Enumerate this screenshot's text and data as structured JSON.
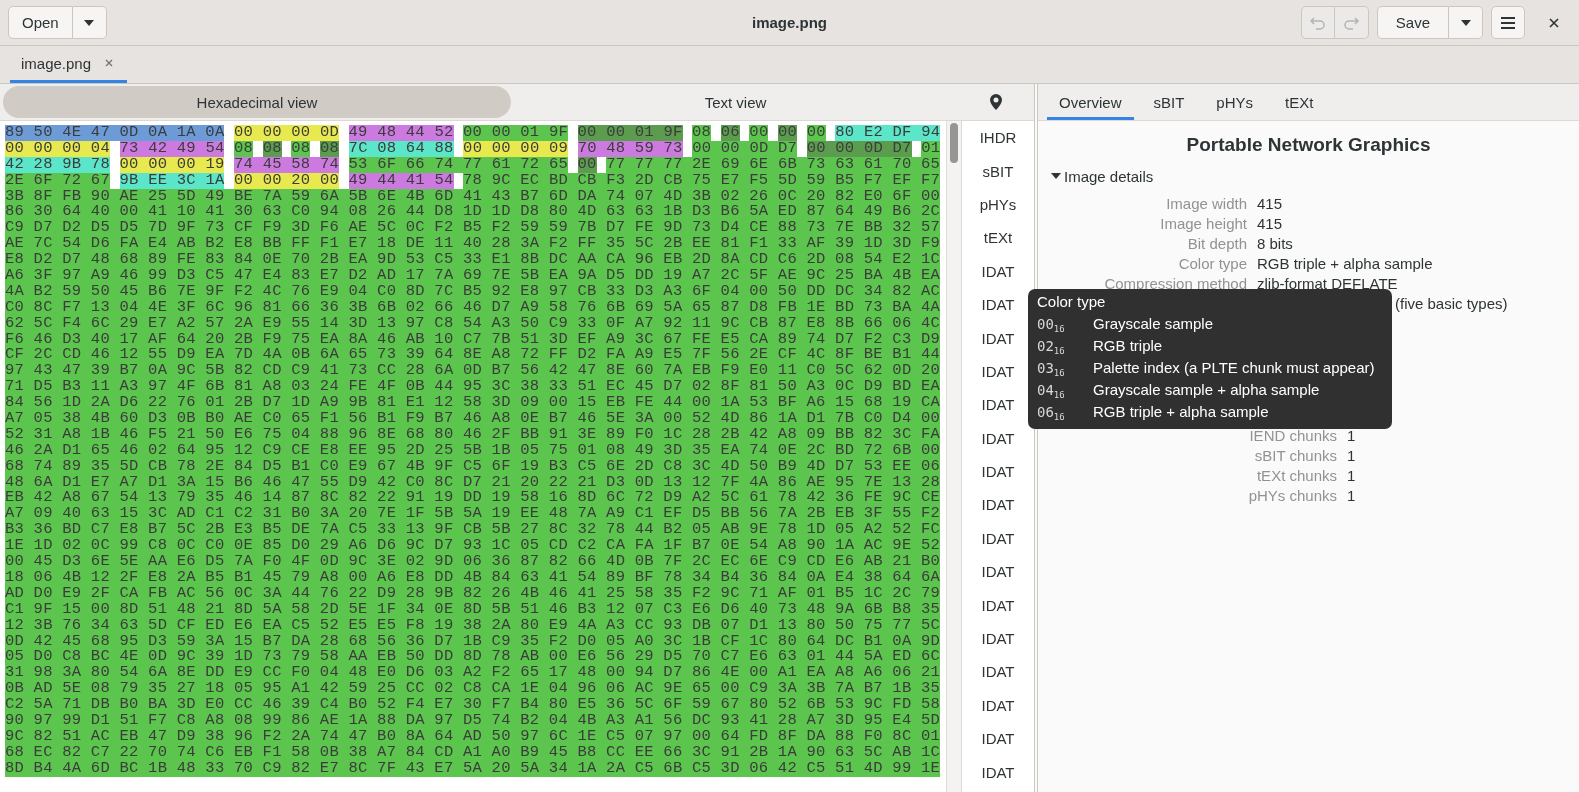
{
  "header": {
    "open_button": "Open",
    "title": "image.png",
    "undo": {
      "disabled": true
    },
    "redo": {
      "disabled": true
    },
    "save_button": "Save"
  },
  "tabs": [
    {
      "label": "image.png",
      "selected": true
    }
  ],
  "view_switch": [
    {
      "label": "Hexadecimal view",
      "selected": true
    },
    {
      "label": "Text view",
      "selected": false
    }
  ],
  "hex_rows": [
    {
      "segments": [
        {
          "bytes": "89 50 4E 47 0D 0A 1A 0A",
          "color": "#6d9bd8"
        },
        {
          "bytes": "00 00 00 0D",
          "color": "#e8e84f"
        },
        {
          "bytes": "49 48 44 52",
          "color": "#cc7adf"
        },
        {
          "bytes": "00 00 01 9F",
          "color": "#5cc54d"
        },
        {
          "bytes": "00 00 01 9F",
          "color": "#5b9c4f"
        },
        {
          "bytes": "08",
          "color": "#5cc54d"
        },
        {
          "bytes": "06",
          "color": "#5b9c4f"
        },
        {
          "bytes": "00",
          "color": "#5cc54d"
        },
        {
          "bytes": "00",
          "color": "#5b9c4f"
        },
        {
          "bytes": "00",
          "color": "#5cc54d"
        },
        {
          "bytes": "80 E2 DF 94",
          "color": "#5ce6c9"
        }
      ]
    },
    {
      "segments": [
        {
          "bytes": "00 00 00 04",
          "color": "#e8e84f"
        },
        {
          "bytes": "73 42 49 54",
          "color": "#cc7adf"
        },
        {
          "bytes": "08",
          "color": "#5cc54d"
        },
        {
          "bytes": "08",
          "color": "#5b9c4f"
        },
        {
          "bytes": "08",
          "color": "#5cc54d"
        },
        {
          "bytes": "08",
          "color": "#5b9c4f"
        },
        {
          "bytes": "7C 08 64 88",
          "color": "#5ce6c9"
        },
        {
          "bytes": "00 00 00 09",
          "color": "#e8e84f"
        },
        {
          "bytes": "70 48 59 73",
          "color": "#cc7adf"
        },
        {
          "bytes": "00 00 0D D7",
          "color": "#5cc54d"
        },
        {
          "bytes": "00 00 0D D7",
          "color": "#5b9c4f"
        },
        {
          "bytes": "01",
          "color": "#5cc54d"
        }
      ]
    },
    {
      "segments": [
        {
          "bytes": "42 28 9B 78",
          "color": "#5ce6c9"
        },
        {
          "bytes": "00 00 00 19",
          "color": "#e8e84f"
        },
        {
          "bytes": "74 45 58 74",
          "color": "#cc7adf"
        },
        {
          "bytes": "53 6F 66 74 77 61 72 65",
          "color": "#5cc54d"
        },
        {
          "bytes": "00",
          "color": "#5b9c4f"
        },
        {
          "bytes": "77 77 77 2E 69 6E 6B 73 63 61 70 65",
          "color": "#5cc54d"
        }
      ]
    },
    {
      "segments": [
        {
          "bytes": "2E 6F 72 67",
          "color": "#5cc54d"
        },
        {
          "bytes": "9B EE 3C 1A",
          "color": "#5ce6c9"
        },
        {
          "bytes": "00 00 20 00",
          "color": "#e8e84f"
        },
        {
          "bytes": "49 44 41 54",
          "color": "#cc7adf"
        },
        {
          "bytes": "78 9C EC BD CB F3 2D CB 75 E7 F5 5D 59 B5 F7 EF F7",
          "color": "#5cc54d"
        }
      ]
    },
    {
      "segments": [
        {
          "bytes": "3B 8F FB 90 AE 25 5D 49 BE 7A 59 6A 5B 6E 4B 6D 41 43 B7 6D DA 74 07 4D 3B 02 26 0C 20 82 E0 6F 00",
          "color": "#5cc54d"
        }
      ]
    },
    {
      "segments": [
        {
          "bytes": "86 30 64 40 00 41 10 41 30 63 C0 94 08 26 44 D8 1D 1D D8 80 4D 63 63 1B D3 B6 5A ED 87 64 49 B6 2C",
          "color": "#5cc54d"
        }
      ]
    },
    {
      "segments": [
        {
          "bytes": "C9 D7 D2 D5 D5 7D 9F 73 CF F9 3D F6 AE 5C 0C F2 B5 F2 59 59 7B D7 FE 9D 73 D4 CE 88 73 7E BB 32 57",
          "color": "#5cc54d"
        }
      ]
    },
    {
      "segments": [
        {
          "bytes": "AE 7C 54 D6 FA E4 AB B2 E8 BB FF F1 E7 18 DE 11 40 28 3A F2 FF 35 5C 2B EE 81 F1 33 AF 39 1D 3D F9",
          "color": "#5cc54d"
        }
      ]
    },
    {
      "segments": [
        {
          "bytes": "E8 D2 D7 48 68 89 FE 83 84 0E 70 2B EA 9D 53 C5 33 E1 8B DC AA CA 96 EB 2D 8A CD C6 2D 08 54 E2 1C",
          "color": "#5cc54d"
        }
      ]
    },
    {
      "segments": [
        {
          "bytes": "A6 3F 97 A9 46 99 D3 C5 47 E4 83 E7 D2 AD 17 7A 69 7E 5B EA 9A D5 DD 19 A7 2C 5F AE 9C 25 BA 4B EA",
          "color": "#5cc54d"
        }
      ]
    },
    {
      "segments": [
        {
          "bytes": "4A B2 59 50 45 B6 7E 9F F2 4C 76 E9 04 C0 8D 7C B5 92 E8 97 CB 33 D3 A3 6F 04 00 50 DD DC 34 82 AC",
          "color": "#5cc54d"
        }
      ]
    },
    {
      "segments": [
        {
          "bytes": "C0 8C F7 13 04 4E 3F 6C 96 81 66 36 3B 6B 02 66 46 D7 A9 58 76 6B 69 5A 65 87 D8 FB 1E BD 73 BA 4A",
          "color": "#5cc54d"
        }
      ]
    },
    {
      "segments": [
        {
          "bytes": "62 5C F4 6C 29 E7 A2 57 2A E9 55 14 3D 13 97 C8 54 A3 50 C9 33 0F A7 92 11 9C CB 87 E8 8B 66 06 4C",
          "color": "#5cc54d"
        }
      ]
    },
    {
      "segments": [
        {
          "bytes": "F6 46 D3 40 17 AF 64 20 2B F9 75 EA 8A 46 AB 10 C7 7B 51 3D EF A9 3C 67 FE E5 CA 89 74 D7 F2 C3 D9",
          "color": "#5cc54d"
        }
      ]
    },
    {
      "segments": [
        {
          "bytes": "CF 2C CD 46 12 55 D9 EA 7D 4A 0B 6A 65 73 39 64 8E A8 72 FF D2 FA A9 E5 7F 56 2E CF 4C 8F BE B1 44",
          "color": "#5cc54d"
        }
      ]
    },
    {
      "segments": [
        {
          "bytes": "97 43 47 39 B7 0A 9C 5B 82 CD C9 41 73 CC 28 6A 0D B7 56 42 47 8E 60 7A EB F9 E0 11 C0 5C 62 0D 20",
          "color": "#5cc54d"
        }
      ]
    },
    {
      "segments": [
        {
          "bytes": "71 D5 B3 11 A3 97 4F 6B 81 A8 03 24 FE 4F 0B 44 95 3C 38 33 51 EC 45 D7 02 8F 81 50 A3 0C D9 BD EA",
          "color": "#5cc54d"
        }
      ]
    },
    {
      "segments": [
        {
          "bytes": "84 56 1D 2A D6 22 76 01 2B D7 1D A9 9B 81 E1 12 58 3D 09 00 15 EB FE 44 00 1A 53 BF A6 15 68 19 CA",
          "color": "#5cc54d"
        }
      ]
    },
    {
      "segments": [
        {
          "bytes": "A7 05 38 4B 60 D3 0B B0 AE C0 65 F1 56 B1 F9 B7 46 A8 0E B7 46 5E 3A 00 52 4D 86 1A D1 7B C0 D4 00",
          "color": "#5cc54d"
        }
      ]
    },
    {
      "segments": [
        {
          "bytes": "52 31 A8 1B 46 F5 21 50 E6 75 04 88 96 8E 68 80 46 2F BB 91 3E 89 F0 1C 28 2B 42 A8 09 BB 82 3C FA",
          "color": "#5cc54d"
        }
      ]
    },
    {
      "segments": [
        {
          "bytes": "46 2A D1 65 46 02 64 95 12 C9 CE E8 EE 95 2D 25 5B 1B 05 75 01 08 49 3D 35 EA 74 0E 2C BD 72 6B 00",
          "color": "#5cc54d"
        }
      ]
    },
    {
      "segments": [
        {
          "bytes": "68 74 89 35 5D CB 78 2E 84 D5 B1 C0 E9 67 4B 9F C5 6F 19 B3 C5 6E 2D C8 3C 4D 50 B9 4D D7 53 EE 06",
          "color": "#5cc54d"
        }
      ]
    },
    {
      "segments": [
        {
          "bytes": "48 6A D1 E7 A7 D1 3A 15 B6 46 47 55 D9 42 C0 8C D7 21 20 22 21 D3 0D 13 12 7F 4A 86 AE 95 7E 13 28",
          "color": "#5cc54d"
        }
      ]
    },
    {
      "segments": [
        {
          "bytes": "EB 42 A8 67 54 13 79 35 46 14 87 8C 82 22 91 19 DD 19 58 16 8D 6C 72 D9 A2 5C 61 78 42 36 FE 9C CE",
          "color": "#5cc54d"
        }
      ]
    },
    {
      "segments": [
        {
          "bytes": "A7 09 40 63 15 3C AD C1 C2 31 B0 3A 20 7E 1F 5B 5A 19 EE 48 7A A9 C1 EF D5 BB 56 7A 2B EB 3F 55 F2",
          "color": "#5cc54d"
        }
      ]
    },
    {
      "segments": [
        {
          "bytes": "B3 36 BD C7 E8 B7 5C 2B E3 B5 DE 7A C5 33 13 9F CB 5B 27 8C 32 78 44 B2 05 AB 9E 78 1D 05 A2 52 FC",
          "color": "#5cc54d"
        }
      ]
    },
    {
      "segments": [
        {
          "bytes": "1E 1D 02 0C 99 C8 0C C0 0E 85 D0 29 A6 D6 9C D7 93 1C 05 CD C2 CA FA 1F B7 0E 54 A8 90 1A AC 9E 52",
          "color": "#5cc54d"
        }
      ]
    },
    {
      "segments": [
        {
          "bytes": "00 45 D3 6E 5E AA E6 D5 7A F0 4F 0D 9C 3E 02 9D 06 36 87 82 66 4D 0B 7F 2C EC 6E C9 CD E6 AB 21 B0",
          "color": "#5cc54d"
        }
      ]
    },
    {
      "segments": [
        {
          "bytes": "18 06 4B 12 2F E8 2A B5 B1 45 79 A8 00 A6 E8 DD 4B 84 63 41 54 89 BF 78 34 B4 36 84 0A E4 38 64 6A",
          "color": "#5cc54d"
        }
      ]
    },
    {
      "segments": [
        {
          "bytes": "AD D0 E9 2F CA FB AC 56 0C 3A 44 76 22 D9 28 9B 82 26 4B 46 41 25 58 35 F2 9C 71 AF 01 B5 1C 2C 79",
          "color": "#5cc54d"
        }
      ]
    },
    {
      "segments": [
        {
          "bytes": "C1 9F 15 00 8D 51 48 21 8D 5A 58 2D 5E 1F 34 0E 8D 5B 51 46 B3 12 07 C3 E6 D6 40 73 48 9A 6B B8 35",
          "color": "#5cc54d"
        }
      ]
    },
    {
      "segments": [
        {
          "bytes": "12 3B 76 34 63 5D CF ED E6 EA C5 52 E5 E5 F8 19 38 2A 80 E9 4A A3 CC 93 DB 07 D1 13 80 50 75 77 5C",
          "color": "#5cc54d"
        }
      ]
    },
    {
      "segments": [
        {
          "bytes": "0D 42 45 68 95 D3 59 3A 15 B7 DA 28 68 56 36 D7 1B C9 35 F2 D0 05 A0 3C 1B CF 1C 80 64 DC B1 0A 9D",
          "color": "#5cc54d"
        }
      ]
    },
    {
      "segments": [
        {
          "bytes": "05 D0 C8 BC 4E 0D 9C 39 1D 73 79 58 AA EB 50 DD 8D 78 AB 00 E6 56 29 D5 70 C7 E6 63 01 44 5A ED 6C",
          "color": "#5cc54d"
        }
      ]
    },
    {
      "segments": [
        {
          "bytes": "31 98 3A 80 54 6A 8E DD E9 CC F0 04 48 E0 D6 03 A2 F2 65 17 48 00 94 D7 86 4E 00 A1 EA A8 A6 06 21",
          "color": "#5cc54d"
        }
      ]
    },
    {
      "segments": [
        {
          "bytes": "0B AD 5E 08 79 35 27 18 05 95 A1 42 59 25 CC 02 C8 CA 1E 04 96 06 AC 9E 65 00 C9 3A 3B 7A B7 1B 35",
          "color": "#5cc54d"
        }
      ]
    },
    {
      "segments": [
        {
          "bytes": "C2 5A 71 DB B0 BA 3D E0 CC 46 39 C4 B0 52 F4 E7 30 F7 B4 80 E5 36 5C 6F 59 67 80 52 6B 53 9C FD 58",
          "color": "#5cc54d"
        }
      ]
    },
    {
      "segments": [
        {
          "bytes": "90 97 99 D1 51 F7 C8 A8 08 99 86 AE 1A 88 DA 97 D5 74 B2 04 4B A3 A1 56 DC 93 41 28 A7 3D 95 E4 5D",
          "color": "#5cc54d"
        }
      ]
    },
    {
      "segments": [
        {
          "bytes": "9C 82 51 AC EB 47 D9 38 96 F2 2A 74 47 B0 8A 64 AD 50 97 6C 1E C5 07 97 00 64 FD 8F DA 88 F0 8C 01",
          "color": "#5cc54d"
        }
      ]
    },
    {
      "segments": [
        {
          "bytes": "68 EC 82 C7 22 70 74 C6 EB F1 58 0B 38 A7 84 CD A1 A0 B9 45 B8 CC EE 66 3C 91 2B 1A 90 63 5C AB 1C",
          "color": "#5cc54d"
        }
      ]
    },
    {
      "segments": [
        {
          "bytes": "8D B4 4A 6D BC 1B 48 33 70 C9 82 E7 8C 7F 43 E7 5A 20 5A 34 1A 2A C5 6B C5 3D 06 42 C5 51 4D 99 1E",
          "color": "#5cc54d"
        }
      ]
    }
  ],
  "chunk_list": [
    {
      "label": "IHDR",
      "selected": false
    },
    {
      "label": "sBIT",
      "selected": false
    },
    {
      "label": "pHYs",
      "selected": false
    },
    {
      "label": "tEXt",
      "selected": false
    },
    {
      "label": "IDAT",
      "selected": false
    },
    {
      "label": "IDAT",
      "selected": false
    },
    {
      "label": "IDAT",
      "selected": false
    },
    {
      "label": "IDAT",
      "selected": false
    },
    {
      "label": "IDAT",
      "selected": false
    },
    {
      "label": "IDAT",
      "selected": false
    },
    {
      "label": "IDAT",
      "selected": false
    },
    {
      "label": "IDAT",
      "selected": false
    },
    {
      "label": "IDAT",
      "selected": false
    },
    {
      "label": "IDAT",
      "selected": false
    },
    {
      "label": "IDAT",
      "selected": false
    },
    {
      "label": "IDAT",
      "selected": false
    },
    {
      "label": "IDAT",
      "selected": false
    },
    {
      "label": "IDAT",
      "selected": false
    },
    {
      "label": "IDAT",
      "selected": false
    },
    {
      "label": "IDAT",
      "selected": false
    }
  ],
  "inspector": {
    "tabs": [
      {
        "label": "Overview",
        "selected": true
      },
      {
        "label": "sBIT",
        "selected": false
      },
      {
        "label": "pHYs",
        "selected": false
      },
      {
        "label": "tEXt",
        "selected": false
      }
    ],
    "title": "Portable Network Graphics",
    "image_details": {
      "title": "Image details",
      "expanded": true,
      "rows": [
        {
          "label": "Image width",
          "value": "415"
        },
        {
          "label": "Image height",
          "value": "415"
        },
        {
          "label": "Bit depth",
          "value": "8 bits"
        },
        {
          "label": "Color type",
          "value": "RGB triple + alpha sample"
        },
        {
          "label": "Compression method",
          "value": "zlib-format DEFLATE"
        }
      ]
    },
    "text_beside_tooltip": "(five basic types)",
    "chunk_count_rows": [
      {
        "label": "IEND chunks",
        "value": "1"
      },
      {
        "label": "sBIT chunks",
        "value": "1"
      },
      {
        "label": "tEXt chunks",
        "value": "1"
      },
      {
        "label": "pHYs chunks",
        "value": "1"
      }
    ]
  },
  "tooltip": {
    "title": "Color type",
    "rows": [
      {
        "code": "00$_{16}$",
        "text": "Grayscale sample"
      },
      {
        "code": "02$_{16}$",
        "text": "RGB triple"
      },
      {
        "code": "03$_{16}$",
        "text": "Palette index (a PLTE chunk must appear)"
      },
      {
        "code": "04$_{16}$",
        "text": "Grayscale sample + alpha sample"
      },
      {
        "code": "06$_{16}$",
        "text": "RGB triple + alpha sample"
      }
    ]
  }
}
